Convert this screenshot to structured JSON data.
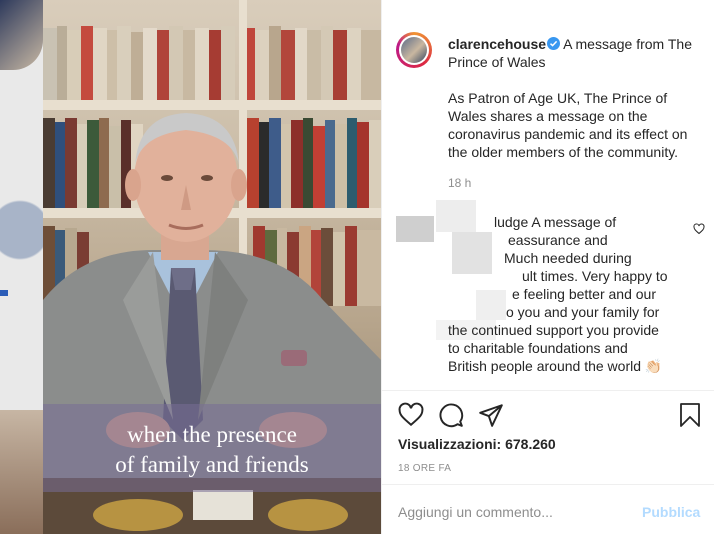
{
  "post": {
    "username": "clarencehouse",
    "caption_title": "A message from The Prince of Wales",
    "description_lines": [
      "As Patron of Age UK, The Prince of",
      "Wales shares a message on the",
      "coronavirus pandemic and its effect on",
      "the older members of the community."
    ],
    "caption_time": "18 h"
  },
  "comment": {
    "lines": [
      "ludge A message of",
      "eassurance and",
      "Much needed during",
      "ult times. Very happy to",
      "e feeling better and our",
      "o you and your family for",
      "the continued support you provide",
      "to charitable foundations and",
      "British people around the world 👏🏻"
    ]
  },
  "stats": {
    "views_label": "Visualizzazioni: 678.260",
    "time_label": "18 ORE FA"
  },
  "composer": {
    "placeholder": "Aggiungi un commento...",
    "publish_label": "Pubblica"
  },
  "video": {
    "caption_lines": [
      "when the presence",
      "of family and friends"
    ]
  },
  "colors": {
    "link_blue": "#3897f0",
    "publish_disabled": "#b3dbff",
    "text": "#262626",
    "muted": "#8e8e8e"
  },
  "icons": [
    "verified-badge-icon",
    "heart-icon",
    "comment-icon",
    "share-icon",
    "bookmark-icon",
    "comment-like-icon"
  ]
}
